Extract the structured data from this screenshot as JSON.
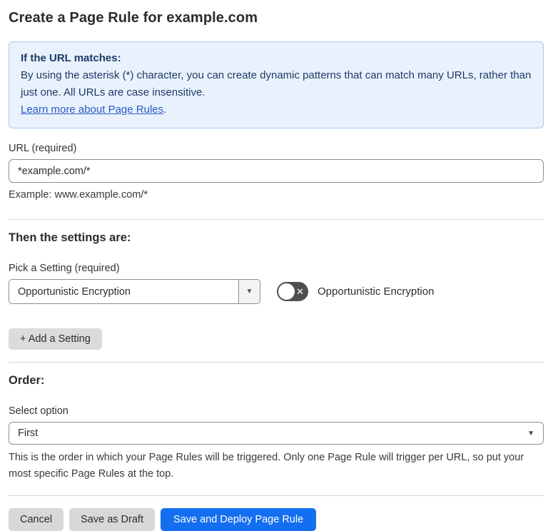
{
  "page": {
    "title": "Create a Page Rule for example.com"
  },
  "info_box": {
    "heading": "If the URL matches:",
    "body": "By using the asterisk (*) character, you can create dynamic patterns that can match many URLs, rather than just one. All URLs are case insensitive.",
    "link_label": "Learn more about Page Rules",
    "link_suffix": "."
  },
  "url_field": {
    "label": "URL (required)",
    "value": "*example.com/*",
    "helper": "Example: www.example.com/*"
  },
  "settings_section": {
    "heading": "Then the settings are:",
    "picker_label": "Pick a Setting (required)",
    "selected_setting": "Opportunistic Encryption",
    "caret_icon": "▼",
    "toggle": {
      "state": "off",
      "x_glyph": "✕",
      "label": "Opportunistic Encryption"
    },
    "add_button_label": "+ Add a Setting"
  },
  "order_section": {
    "heading": "Order:",
    "label": "Select option",
    "selected_option": "First",
    "caret_icon": "▼",
    "helper": "This is the order in which your Page Rules will be triggered. Only one Page Rule will trigger per URL, so put your most specific Page Rules at the top."
  },
  "actions": {
    "cancel_label": "Cancel",
    "save_draft_label": "Save as Draft",
    "save_deploy_label": "Save and Deploy Page Rule"
  },
  "colors": {
    "primary_blue": "#146EF0",
    "info_background": "#E9F2FC",
    "info_border": "#A9C9EE",
    "info_text": "#1E3A68",
    "link_blue": "#2B5AC4",
    "toggle_off_gray": "#4F4F4F",
    "button_gray": "#D8D8D8",
    "border_gray": "#8E8E8E"
  }
}
